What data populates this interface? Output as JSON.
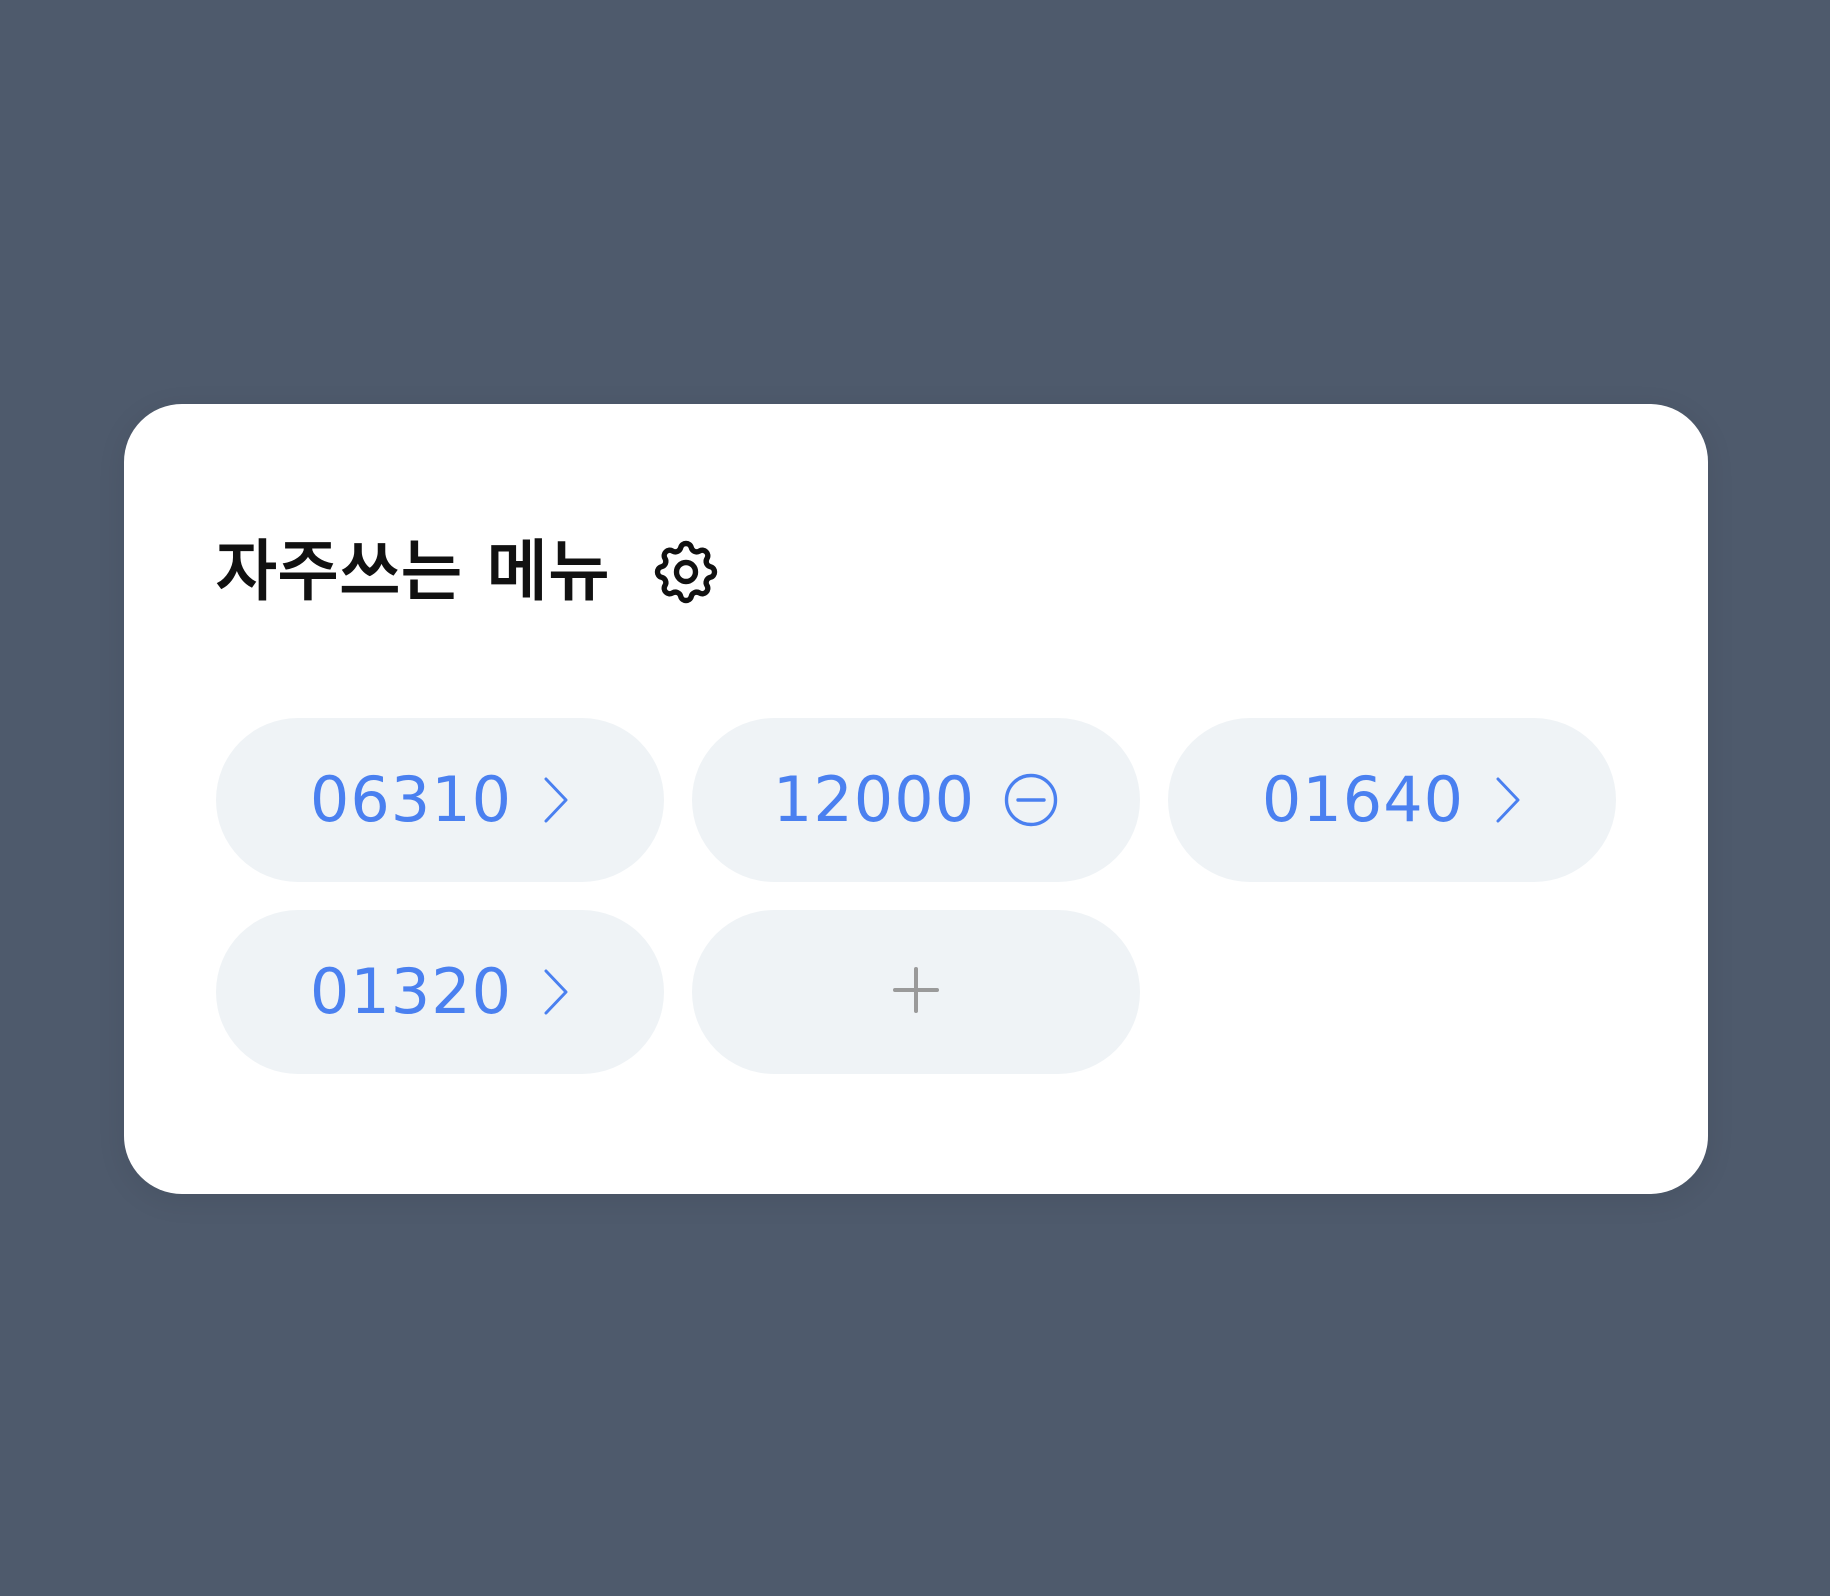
{
  "widget": {
    "title": "자주쓰는 메뉴",
    "settings_icon": "gear-icon"
  },
  "menu_items": [
    {
      "code": "06310",
      "icon": "chevron-right-icon"
    },
    {
      "code": "12000",
      "icon": "minus-circle-icon"
    },
    {
      "code": "01640",
      "icon": "chevron-right-icon"
    },
    {
      "code": "01320",
      "icon": "chevron-right-icon"
    }
  ],
  "add_item": {
    "icon": "plus-icon"
  },
  "colors": {
    "page_background": "#4e5a6c",
    "card_background": "#ffffff",
    "pill_background": "#eff3f6",
    "accent": "#4a80f0",
    "add_icon": "#9a9a9a",
    "title_text": "#111111"
  }
}
